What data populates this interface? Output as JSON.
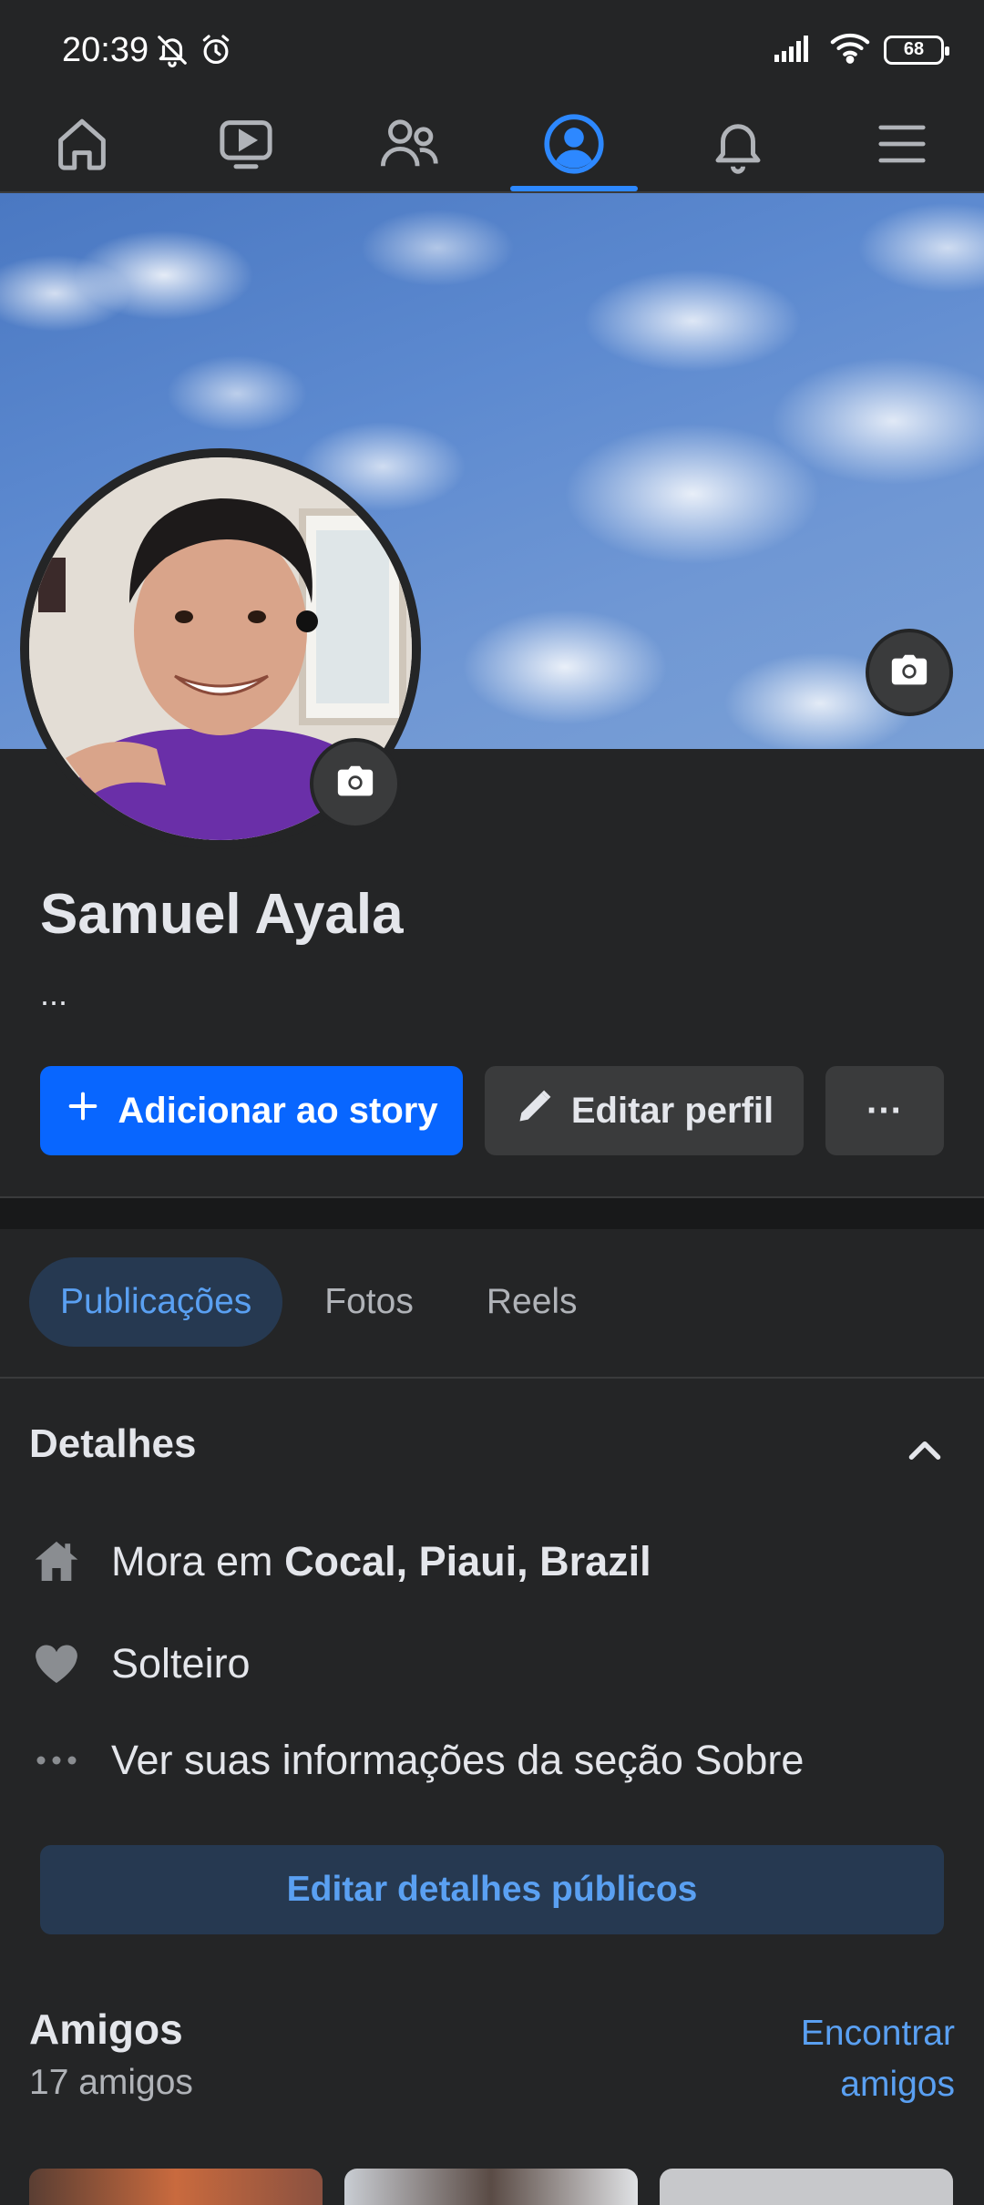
{
  "status_bar": {
    "time": "20:39",
    "battery": "68"
  },
  "nav": {
    "tabs": [
      {
        "name": "home",
        "icon": "home-icon"
      },
      {
        "name": "watch",
        "icon": "video-icon"
      },
      {
        "name": "friends",
        "icon": "friends-icon"
      },
      {
        "name": "profile",
        "icon": "profile-icon",
        "active": true
      },
      {
        "name": "notifications",
        "icon": "bell-icon"
      },
      {
        "name": "menu",
        "icon": "hamburger-menu-icon"
      }
    ]
  },
  "profile": {
    "name": "Samuel Ayala",
    "bio": "...",
    "add_story_label": "Adicionar ao story",
    "edit_profile_label": "Editar perfil",
    "more_label": "···"
  },
  "tabs": [
    {
      "label": "Publicações",
      "active": true
    },
    {
      "label": "Fotos"
    },
    {
      "label": "Reels"
    }
  ],
  "details": {
    "title": "Detalhes",
    "lives_in_prefix": "Mora em",
    "lives_in_place": "Cocal, Piaui, Brazil",
    "relationship": "Solteiro",
    "about_link": "Ver suas informações da seção Sobre",
    "edit_button": "Editar detalhes públicos"
  },
  "friends": {
    "title": "Amigos",
    "count": "17 amigos",
    "find_line1": "Encontrar",
    "find_line2": "amigos"
  },
  "colors": {
    "background": "#242526",
    "accent": "#0866ff",
    "link": "#5aa0f2",
    "active_tab": "#2d88ff"
  }
}
